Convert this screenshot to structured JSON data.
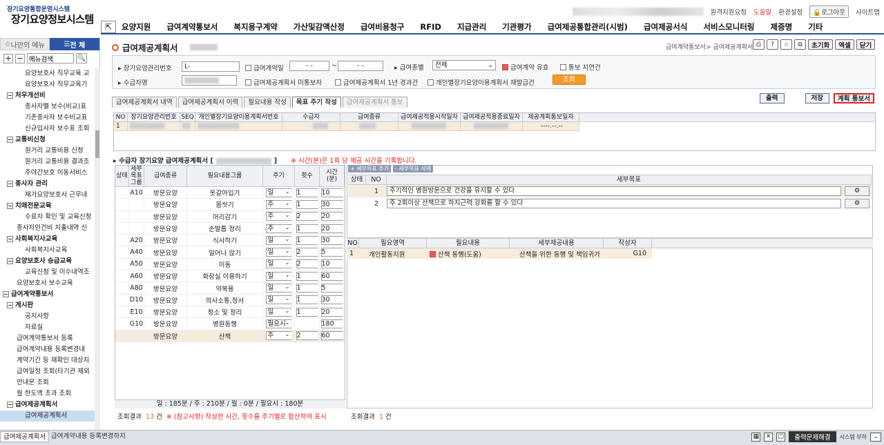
{
  "header": {
    "logo_small": "장기요양통합운영시스템",
    "logo_big": "장기요양정보시스템",
    "util": [
      "원격지원요청",
      "도움말",
      "환경설정",
      "로그아웃",
      "사이트맵"
    ]
  },
  "menu": [
    "요양지원",
    "급여계약통보서",
    "복지용구계약",
    "가산및감액산정",
    "급여비용청구",
    "RFID",
    "지급관리",
    "기관평가",
    "급여제공통합관리(시범)",
    "급여제공서식",
    "서비스모니터링",
    "제증명",
    "기타"
  ],
  "sidebar": {
    "tab_my": "나만의 메뉴",
    "tab_all": "전 체",
    "search_placeholder": "메뉴검색",
    "items": [
      {
        "label": "요양보호사 직무교육 교",
        "level": "l3"
      },
      {
        "label": "요양보호사 직무교육기",
        "level": "l3"
      },
      {
        "label": "처우개선비",
        "level": "l2b"
      },
      {
        "label": "종사자별 보수(비교)표",
        "level": "l3"
      },
      {
        "label": "기존종사자 보수비교표",
        "level": "l3"
      },
      {
        "label": "신규입사자 보수표 조회",
        "level": "l3"
      },
      {
        "label": "교통비신청",
        "level": "l2b"
      },
      {
        "label": "원거리 교통비용 신청",
        "level": "l3"
      },
      {
        "label": "원거리 교통비용 결과조",
        "level": "l3"
      },
      {
        "label": "주야간보호 이동서비스",
        "level": "l3"
      },
      {
        "label": "종사자 관리",
        "level": "l2b"
      },
      {
        "label": "재가요양보호사 근무내",
        "level": "l3"
      },
      {
        "label": "치매전문교육",
        "level": "l2b"
      },
      {
        "label": "수료자 확인 및 교육신청",
        "level": "l3"
      },
      {
        "label": "종사자인건비 지출내역 신",
        "level": "l2"
      },
      {
        "label": "사회복지사교육",
        "level": "l2b"
      },
      {
        "label": "사회복지사교육",
        "level": "l3"
      },
      {
        "label": "요양보호사 승급교육",
        "level": "l2b"
      },
      {
        "label": "교육신청 및 이수내역조",
        "level": "l3"
      },
      {
        "label": "요양보호사 보수교육",
        "level": "l2"
      },
      {
        "label": "급여계약통보서",
        "level": "l1"
      },
      {
        "label": "게시판",
        "level": "l2b"
      },
      {
        "label": "공지사항",
        "level": "l3"
      },
      {
        "label": "자료실",
        "level": "l3"
      },
      {
        "label": "급여계약통보서 등록",
        "level": "l2"
      },
      {
        "label": "급여계약내용 등록변경내",
        "level": "l2"
      },
      {
        "label": "계약기간 등 재확인 대상지",
        "level": "l2"
      },
      {
        "label": "급여일정 조회(타기관 제외",
        "level": "l2"
      },
      {
        "label": "안내문 조회",
        "level": "l2"
      },
      {
        "label": "월 한도액 초과 조회",
        "level": "l2"
      },
      {
        "label": "급여제공계획서",
        "level": "l2b"
      },
      {
        "label": "급여제공계획서",
        "level": "l3",
        "selected": true
      }
    ]
  },
  "page": {
    "title": "급여제공계획서",
    "breadcrumb": "급여계약통보서> 급여제공계획서",
    "btn_init": "초기화",
    "btn_excel": "엑셀",
    "btn_close": "닫기"
  },
  "filter": {
    "label_no": "장기요양관리번호",
    "value_no": "L-",
    "label_contract_date": "급여계약일",
    "date_from": "- -",
    "date_sep": "~",
    "date_to": "- -",
    "label_type": "급여종별",
    "type_value": "전체",
    "label_valid": "급여계약 유효",
    "label_notice_delay": "통보 지연건",
    "label_name": "수급자명",
    "label_unregistered": "급여제공계획서 미통보자",
    "label_one_year": "급여제공계획서 1년 경과건",
    "label_reestablish": "개인별장기요양이용계획서 재발급건",
    "btn_search": "조회"
  },
  "tabs": [
    "급여제공계획서 내역",
    "급여제공계획서 이력",
    "필요내용 작성",
    "목표 주기 작성",
    "급여제공계획서 통보"
  ],
  "action_buttons": {
    "print": "출력",
    "save": "저장",
    "notify": "계획 통보서"
  },
  "grid1": {
    "headers": [
      "NO",
      "장기요양관리번호",
      "SEQ",
      "개인별장기요양이용계획서번호",
      "수급자",
      "급여종류",
      "급여제공적용시작일자",
      "급여제공적용종료일자",
      "제공계획통보일자"
    ],
    "row": {
      "no": "1",
      "notice_date": "----.--.--"
    }
  },
  "section": {
    "title": "수급자 장기요양 급여제공계획서 [",
    "bracket_end": "]",
    "warning": "※ 시간(분)은 1회 당 제공 시간을 기록합니다."
  },
  "left_table": {
    "headers": [
      "상태",
      "세부목표그룹",
      "급여종류",
      "필요내용그룹",
      "주기",
      "횟수",
      "시간(분)"
    ],
    "rows": [
      {
        "code": "A10",
        "kind": "방문요양",
        "group": "옷갈아입기",
        "cycle": "일",
        "count": "1",
        "time": "10"
      },
      {
        "code": "",
        "kind": "방문요양",
        "group": "몸씻기",
        "cycle": "주",
        "count": "1",
        "time": "30"
      },
      {
        "code": "",
        "kind": "방문요양",
        "group": "머리감기",
        "cycle": "주",
        "count": "2",
        "time": "20"
      },
      {
        "code": "",
        "kind": "방문요양",
        "group": "손발톱 정리",
        "cycle": "주",
        "count": "1",
        "time": "20"
      },
      {
        "code": "A20",
        "kind": "방문요양",
        "group": "식사하기",
        "cycle": "일",
        "count": "1",
        "time": "30"
      },
      {
        "code": "A40",
        "kind": "방문요양",
        "group": "일어나 앉기",
        "cycle": "일",
        "count": "2",
        "time": "5"
      },
      {
        "code": "A50",
        "kind": "방문요양",
        "group": "이동",
        "cycle": "일",
        "count": "2",
        "time": "10"
      },
      {
        "code": "A60",
        "kind": "방문요양",
        "group": "화장실 이용하기",
        "cycle": "일",
        "count": "1",
        "time": "60"
      },
      {
        "code": "A80",
        "kind": "방문요양",
        "group": "약복용",
        "cycle": "일",
        "count": "1",
        "time": "5"
      },
      {
        "code": "D10",
        "kind": "방문요양",
        "group": "의사소통,정서",
        "cycle": "일",
        "count": "1",
        "time": "30"
      },
      {
        "code": "E10",
        "kind": "방문요양",
        "group": "청소 및 정리",
        "cycle": "일",
        "count": "1",
        "time": "20"
      },
      {
        "code": "G10",
        "kind": "방문요양",
        "group": "병원동행",
        "cycle": "필요시",
        "count": "",
        "time": "180"
      },
      {
        "code": "",
        "kind": "방문요양",
        "group": "산책",
        "cycle": "주",
        "count": "2",
        "time": "60",
        "selected": true
      }
    ],
    "summary": "일 : 185분 / 주 : 210분 / 월 : 0분 / 필요시 : 180분",
    "result_label": "조회결과",
    "result_count": "13",
    "result_unit": "건",
    "result_note": "※ (참고사항) 작성한 시간, 횟수를 주기별로 합산하여 표시"
  },
  "goals": {
    "btn_add": "+ 세부목표 추가",
    "btn_del": "- 세부목표 삭제",
    "headers": [
      "상태",
      "NO",
      "세부목표"
    ],
    "rows": [
      {
        "no": "1",
        "text": "주기적인 병원방문으로 건강을 유지할 수 있다"
      },
      {
        "no": "2",
        "text": "주 2회이상 산책으로 하지근력 강화를 할 수 있다"
      }
    ],
    "icon_label": "⚙"
  },
  "details": {
    "headers": [
      "NO",
      "필요영역",
      "필요내용",
      "세부제공내용",
      "작성자"
    ],
    "rows": [
      {
        "no": "1",
        "area": "개인활동지원",
        "content": "산책 동행(도움)",
        "detail": "산책을 위한 동행 및 책임귀가",
        "writer": "G10"
      }
    ],
    "result_label": "조회결과",
    "result_count": "1",
    "result_unit": "건"
  },
  "bottom": {
    "tab1": "급여제공계획서",
    "tab2": "급여계약내용 등록변경하지",
    "print_btn": "출력문제해결",
    "system_load": "시스템 부하"
  }
}
